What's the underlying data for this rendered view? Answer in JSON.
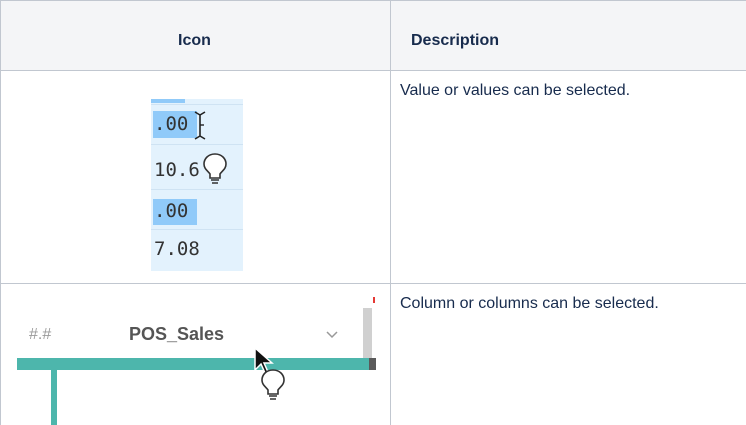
{
  "table": {
    "headers": {
      "icon": "Icon",
      "description": "Description"
    },
    "rows": [
      {
        "description": "Value or values can be selected.",
        "image": {
          "values": [
            ".00",
            "10.6",
            ".00",
            "7.08"
          ]
        }
      },
      {
        "description": "Column or columns can be selected.",
        "image": {
          "type_marker": "#.#",
          "column_name": "POS_Sales"
        }
      }
    ]
  },
  "colors": {
    "header_bg": "#f4f5f7",
    "border": "#c1c7d0",
    "selection_bg": "#90caf9",
    "cell_bg": "#e3f2fd",
    "teal_bar": "#4db6ac"
  }
}
